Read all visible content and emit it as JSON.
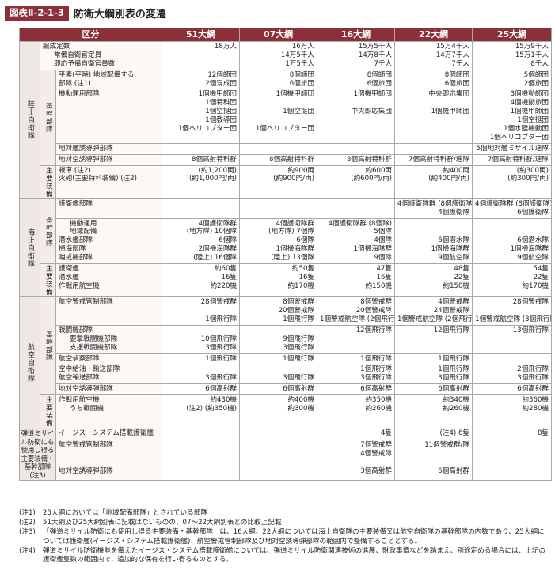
{
  "figure": {
    "label": "図表Ⅱ-2-1-3",
    "title": "防衛大綱別表の変遷"
  },
  "header": [
    "区分",
    "51大綱",
    "07大綱",
    "16大綱",
    "22大綱",
    "25大綱"
  ],
  "groups": {
    "gsdf": "陸上自衛隊",
    "msdf": "海上自衛隊",
    "asdf": "航空自衛隊",
    "bmd": "弾道ミサイル防衛にも使用し得る主要装備・基幹部隊(注3)",
    "kikan": "基幹部隊",
    "shuyo": "主要装備"
  },
  "gsdf": {
    "rows": [
      {
        "labels": [
          "編成定数",
          "常備自衛官定員",
          "即応予備自衛官員数"
        ],
        "cols": [
          [
            "18万人",
            "",
            ""
          ],
          [
            "16万人",
            "14万5千人",
            "1万5千人"
          ],
          [
            "15万5千人",
            "14万8千人",
            "7千人"
          ],
          [
            "15万4千人",
            "14万7千人",
            "7千人"
          ],
          [
            "15万9千人",
            "15万1千人",
            "8千人"
          ]
        ]
      },
      {
        "labels": [
          "平素(平時) 地域配備する",
          "部隊 (注1)"
        ],
        "cols": [
          [
            "12個師団",
            "2個混成団"
          ],
          [
            "8個師団",
            "6個旅団"
          ],
          [
            "8個師団",
            "6個旅団"
          ],
          [
            "8個師団",
            "6個旅団"
          ],
          [
            "5個師団",
            "2個旅団"
          ]
        ]
      },
      {
        "labels": [
          "機動運用部隊"
        ],
        "cols": [
          [
            "1個機甲師団",
            "1個特科団",
            "1個空挺団",
            "1個教導団",
            "1個ヘリコプター団",
            ""
          ],
          [
            "1個機甲師団",
            "",
            "1個空挺団",
            "",
            "1個ヘリコプター団",
            ""
          ],
          [
            "1個機甲師団",
            "",
            "中央即応集団",
            "",
            "",
            ""
          ],
          [
            "中央即応集団",
            "",
            "1個機甲師団",
            "",
            "",
            ""
          ],
          [
            "3個機動師団",
            "4個機動旅団",
            "1個機甲師団",
            "1個空挺団",
            "1個水陸機動団",
            "1個ヘリコプター団"
          ]
        ]
      },
      {
        "labels": [
          "地対艦誘導弾部隊"
        ],
        "cols": [
          [
            ""
          ],
          [
            ""
          ],
          [
            ""
          ],
          [
            ""
          ],
          [
            "5個地対艦ミサイル連隊"
          ]
        ]
      },
      {
        "labels": [
          "地対空誘導弾部隊"
        ],
        "cols": [
          [
            "8個高射特科群"
          ],
          [
            "8個高射特科群"
          ],
          [
            "8個高射特科群"
          ],
          [
            "7個高射特科群/連隊"
          ],
          [
            "7個高射特科群/連隊"
          ]
        ]
      },
      {
        "labels": [
          "戦車 (注2)",
          "火砲(主要特科装備) (注2)"
        ],
        "cols": [
          [
            "(約1,200両)",
            "(約1,000門/両)"
          ],
          [
            "約900両",
            "(約900門/両)"
          ],
          [
            "約600両",
            "(約600門/両)"
          ],
          [
            "約400両",
            "(約400門/両)"
          ],
          [
            "(約300両)",
            "(約300門/両)"
          ]
        ]
      }
    ]
  },
  "msdf": {
    "rows": [
      {
        "labels": [
          "護衛艦部隊"
        ],
        "cols": [
          [
            ""
          ],
          [
            ""
          ],
          [
            ""
          ],
          [
            "4個護衛隊群 (8個護衛隊)",
            "4個護衛隊"
          ],
          [
            "4個護衛隊群 (8個護衛隊)",
            "6個護衛隊"
          ]
        ]
      },
      {
        "labels": [
          "機動運用",
          "地域配備",
          "潜水艦部隊",
          "掃海部隊",
          "哨戒機部隊"
        ],
        "cols": [
          [
            "4個護衛隊群",
            "(地方隊) 10個隊",
            "6個隊",
            "2個掃海隊群",
            "(陸上) 16個隊"
          ],
          [
            "4個護衛隊群",
            "(地方隊) 7個隊",
            "6個隊",
            "1個掃海隊群",
            "(陸上) 13個隊"
          ],
          [
            "4個護衛隊群 (8個隊)",
            "5個隊",
            "4個隊",
            "1個掃海隊群",
            "9個隊"
          ],
          [
            "",
            "",
            "6個潜水隊",
            "1個掃海隊群",
            "9個航空隊"
          ],
          [
            "",
            "",
            "6個潜水隊",
            "1個掃海隊群",
            "9個航空隊"
          ]
        ]
      },
      {
        "labels": [
          "護衛艦",
          "潜水艦",
          "作戦用航空機"
        ],
        "cols": [
          [
            "約60隻",
            "16隻",
            "約220機"
          ],
          [
            "約50隻",
            "16隻",
            "約170機"
          ],
          [
            "47隻",
            "16隻",
            "約150機"
          ],
          [
            "48隻",
            "22隻",
            "約150機"
          ],
          [
            "54隻",
            "22隻",
            "約170機"
          ]
        ]
      }
    ]
  },
  "asdf": {
    "rows": [
      {
        "labels": [
          "航空警戒管制部隊"
        ],
        "cols": [
          [
            "28個警戒群",
            "",
            "1個飛行隊"
          ],
          [
            "8個警戒群",
            "20個警戒隊",
            "1個飛行隊"
          ],
          [
            "8個警戒群",
            "20個警戒隊",
            "1個警戒航空隊 (2個飛行隊)"
          ],
          [
            "4個警戒群",
            "24個警戒隊",
            "1個警戒航空隊 (2個飛行隊)"
          ],
          [
            "28個警戒隊",
            "",
            "1個警戒航空隊 (3個飛行隊)"
          ]
        ]
      },
      {
        "labels": [
          "戦闘機部隊",
          "要撃戦闘機部隊",
          "支援戦闘機部隊"
        ],
        "cols": [
          [
            "",
            "10個飛行隊",
            "3個飛行隊"
          ],
          [
            "",
            "9個飛行隊",
            "3個飛行隊"
          ],
          [
            "12個飛行隊",
            "",
            ""
          ],
          [
            "12個飛行隊",
            "",
            ""
          ],
          [
            "13個飛行隊",
            "",
            ""
          ]
        ]
      },
      {
        "labels": [
          "航空偵察部隊"
        ],
        "cols": [
          [
            "1個飛行隊"
          ],
          [
            "1個飛行隊"
          ],
          [
            "1個飛行隊"
          ],
          [
            "1個飛行隊"
          ],
          [
            ""
          ]
        ]
      },
      {
        "labels": [
          "空中給油・輸送部隊",
          "航空輸送部隊"
        ],
        "cols": [
          [
            "",
            "3個飛行隊"
          ],
          [
            "",
            "3個飛行隊"
          ],
          [
            "1個飛行隊",
            "3個飛行隊"
          ],
          [
            "1個飛行隊",
            "3個飛行隊"
          ],
          [
            "2個飛行隊",
            "3個飛行隊"
          ]
        ]
      },
      {
        "labels": [
          "地対空誘導弾部隊"
        ],
        "cols": [
          [
            "6個高射群"
          ],
          [
            "6個高射群"
          ],
          [
            "6個高射群"
          ],
          [
            "6個高射群"
          ],
          [
            "6個高射群"
          ]
        ]
      },
      {
        "labels": [
          "作戦用航空機",
          "うち戦闘機"
        ],
        "cols": [
          [
            "約430機",
            "(注2) (約350機)"
          ],
          [
            "約400機",
            "約300機"
          ],
          [
            "約350機",
            "約260機"
          ],
          [
            "約340機",
            "約260機"
          ],
          [
            "約360機",
            "約280機"
          ]
        ]
      }
    ]
  },
  "bmd": {
    "rows": [
      {
        "labels": [
          "イージス・システム搭載護衛艦"
        ],
        "cols": [
          [
            ""
          ],
          [
            ""
          ],
          [
            "4隻"
          ],
          [
            "(注4) 6隻"
          ],
          [
            "8隻"
          ]
        ]
      },
      {
        "labels": [
          "航空警戒管制部隊",
          "",
          "",
          "地対空誘導弾部隊"
        ],
        "cols": [
          [
            "",
            "",
            "",
            ""
          ],
          [
            "",
            "",
            "",
            ""
          ],
          [
            "7個警戒群",
            "4個警戒隊",
            "",
            "3個高射群"
          ],
          [
            "11個警戒群/隊",
            "",
            "",
            "6個高射群"
          ],
          [
            "",
            "",
            "",
            ""
          ]
        ]
      }
    ]
  },
  "notes": [
    {
      "key": "(注1)",
      "text": "25大綱においては「地域配備部隊」とされている部隊"
    },
    {
      "key": "(注2)",
      "text": "51大綱及び25大綱別表に記載はないものの、07～22大綱別表との比較上記載"
    },
    {
      "key": "(注3)",
      "text": "「弾道ミサイル防衛にも使用し得る主要装備・基幹部隊」は、16大綱、22大綱については海上自衛隊の主要装備又は航空自衛隊の基幹部隊の内数であり、25大綱については護衛艦(イージス・システム搭載護衛艦)、航空警戒管制部隊及び地対空誘導弾部隊の範囲内で整備することとする。"
    },
    {
      "key": "(注4)",
      "text": "弾道ミサイル防衛機能を備えたイージス・システム搭載護衛艦については、弾道ミサイル防衛関連技術の進展、財政事情などを踏まえ、別途定める場合には、上記の護衛艦隻数の範囲内で、追加的な保有を行い得るものとする。"
    }
  ]
}
